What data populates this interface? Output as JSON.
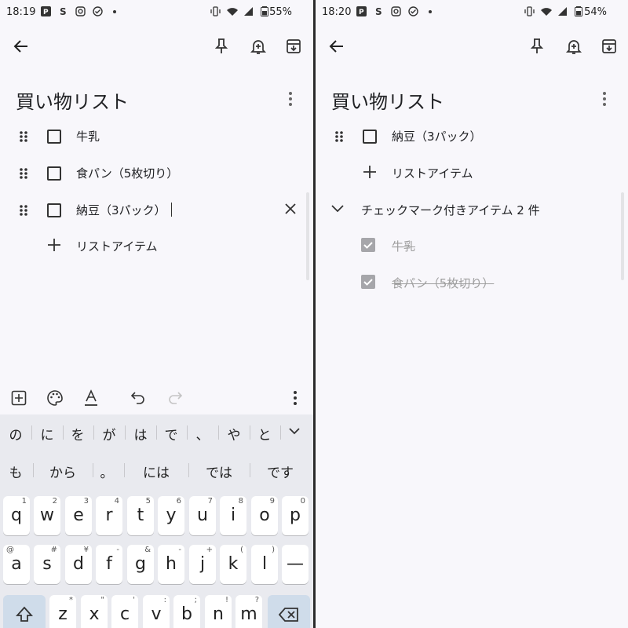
{
  "left": {
    "status": {
      "time": "18:19",
      "battery_pct": "55%"
    },
    "note_title": "買い物リスト",
    "items": [
      {
        "label": "牛乳"
      },
      {
        "label": "食パン（5枚切り）"
      },
      {
        "label": "納豆（3パック）"
      }
    ],
    "add_item_label": "リストアイテム",
    "suggestions": {
      "row1": [
        "の",
        "に",
        "を",
        "が",
        "は",
        "で",
        "、",
        "や",
        "と"
      ],
      "row2": [
        "も",
        "から",
        "。",
        "には",
        "では",
        "です"
      ]
    },
    "keys": {
      "row1": [
        {
          "k": "q",
          "h": "1"
        },
        {
          "k": "w",
          "h": "2"
        },
        {
          "k": "e",
          "h": "3"
        },
        {
          "k": "r",
          "h": "4"
        },
        {
          "k": "t",
          "h": "5"
        },
        {
          "k": "y",
          "h": "6"
        },
        {
          "k": "u",
          "h": "7"
        },
        {
          "k": "i",
          "h": "8"
        },
        {
          "k": "o",
          "h": "9"
        },
        {
          "k": "p",
          "h": "0"
        }
      ],
      "row2": [
        {
          "k": "a",
          "h": "@"
        },
        {
          "k": "s",
          "h": "#"
        },
        {
          "k": "d",
          "h": "¥"
        },
        {
          "k": "f",
          "h": "-"
        },
        {
          "k": "g",
          "h": "&"
        },
        {
          "k": "h",
          "h": "-"
        },
        {
          "k": "j",
          "h": "+"
        },
        {
          "k": "k",
          "h": "("
        },
        {
          "k": "l",
          "h": ")"
        },
        {
          "k": "—",
          "h": ""
        }
      ],
      "row3": [
        {
          "k": "z",
          "h": "*"
        },
        {
          "k": "x",
          "h": "\""
        },
        {
          "k": "c",
          "h": "'"
        },
        {
          "k": "v",
          "h": ":"
        },
        {
          "k": "b",
          "h": ";"
        },
        {
          "k": "n",
          "h": "!"
        },
        {
          "k": "m",
          "h": "?"
        }
      ]
    }
  },
  "right": {
    "status": {
      "time": "18:20",
      "battery_pct": "54%"
    },
    "note_title": "買い物リスト",
    "items": [
      {
        "label": "納豆（3パック）"
      }
    ],
    "add_item_label": "リストアイテム",
    "checked_header": "チェックマーク付きアイテム 2 件",
    "checked_items": [
      {
        "label": "牛乳"
      },
      {
        "label": "食パン（5枚切り）"
      }
    ]
  },
  "icons": {
    "back": "arrow-left-icon",
    "pin": "pin-icon",
    "reminder": "bell-plus-icon",
    "archive": "archive-icon",
    "more": "more-vert-icon"
  }
}
